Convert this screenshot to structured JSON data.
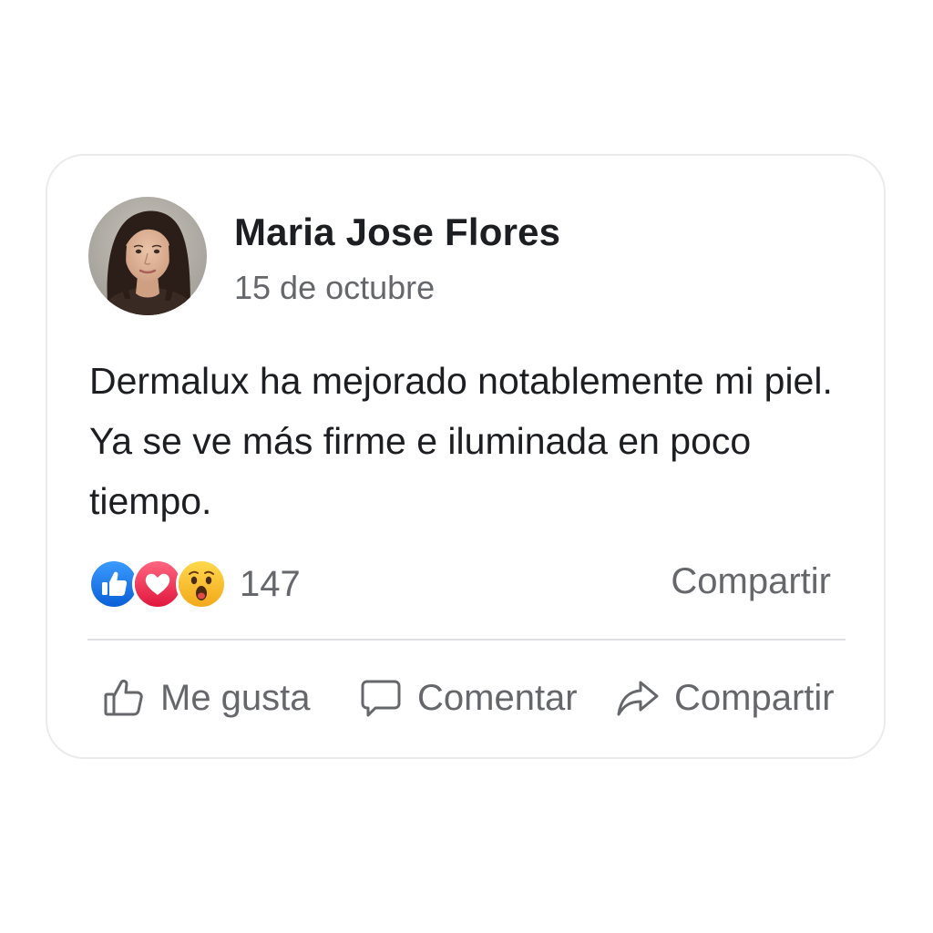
{
  "post": {
    "author": "Maria Jose Flores",
    "date": "15 de octubre",
    "text": "Dermalux ha mejorado notablemente mi piel. Ya se ve más firme e iluminada en poco tiempo."
  },
  "reactions": {
    "types": [
      "like",
      "love",
      "wow"
    ],
    "count": "147",
    "share_link": "Compartir"
  },
  "actions": {
    "like_label": "Me gusta",
    "comment_label": "Comentar",
    "share_label": "Compartir"
  },
  "icons": {
    "avatar": "profile-photo",
    "like": "thumbs-up-icon",
    "comment": "speech-bubble-icon",
    "share": "share-arrow-icon"
  },
  "colors": {
    "like_blue": "#1877f2",
    "love_red": "#f33e58",
    "wow_yellow": "#f7b928",
    "muted_text": "#65676b",
    "primary_text": "#1c1e21"
  }
}
